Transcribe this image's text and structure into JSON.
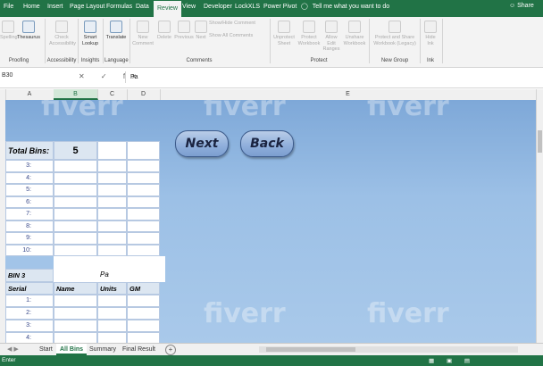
{
  "ribbon_tabs": [
    "File",
    "Home",
    "Insert",
    "Page Layout",
    "Formulas",
    "Data",
    "Review",
    "View",
    "Developer",
    "LockXLS",
    "Power Pivot"
  ],
  "active_tab": "Review",
  "tell_me": "Tell me what you want to do",
  "share": "Share",
  "ribbon": {
    "proofing": {
      "spelling": "Spelling",
      "thesaurus": "Thesaurus",
      "label": "Proofing"
    },
    "accessibility": {
      "check": "Check Accessibility",
      "label": "Accessibility"
    },
    "insights": {
      "smart_lookup": "Smart Lookup",
      "label": "Insights"
    },
    "language": {
      "translate": "Translate",
      "label": "Language"
    },
    "comments": {
      "new_comment": "New Comment",
      "delete": "Delete",
      "previous": "Previous",
      "next": "Next",
      "show_hide": "Show/Hide Comment",
      "show_all": "Show All Comments",
      "label": "Comments"
    },
    "protect": {
      "unprotect_sheet": "Unprotect Sheet",
      "protect_workbook": "Protect Workbook",
      "allow_edit": "Allow Edit Ranges",
      "unshare": "Unshare Workbook",
      "label": "Protect"
    },
    "new_group": {
      "protect_share": "Protect and Share Workbook (Legacy)",
      "label": "New Group"
    },
    "ink": {
      "hide_ink": "Hide Ink",
      "label": "Ink"
    }
  },
  "formula_bar": {
    "name_box": "B30",
    "icons": "✕ ✓ fx",
    "content": "Pa"
  },
  "columns": [
    "A",
    "B",
    "C",
    "D",
    "E"
  ],
  "sheet": {
    "watermark": "fiverr",
    "next_button": "Next",
    "back_button": "Back",
    "total_bins_label": "Total Bins:",
    "total_bins_value": "5",
    "rows_top": [
      "3:",
      "4:",
      "5:",
      "6:",
      "7:",
      "8:",
      "9:",
      "10:"
    ],
    "bin_label": "BIN 3",
    "edit_text": "Pa",
    "headers": {
      "serial": "Serial",
      "name": "Name",
      "units": "Units",
      "gm": "GM"
    },
    "rows_bottom": [
      "1:",
      "2:",
      "3:",
      "4:"
    ]
  },
  "sheet_tabs": [
    "Start",
    "All Bins",
    "Summary",
    "Final Result"
  ],
  "active_sheet": "All Bins",
  "status": "Enter",
  "colors": {
    "excel_green": "#217346",
    "sheet_blue": "#9cc0e6",
    "button_blue": "#8eaedb"
  }
}
